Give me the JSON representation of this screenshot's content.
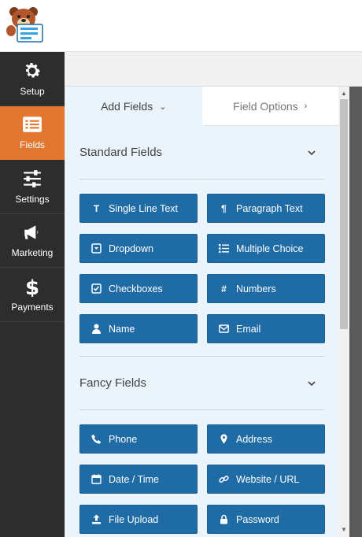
{
  "sidebar": {
    "items": [
      {
        "label": "Setup",
        "icon": "gear-icon"
      },
      {
        "label": "Fields",
        "icon": "fields-list-icon",
        "active": true
      },
      {
        "label": "Settings",
        "icon": "sliders-icon"
      },
      {
        "label": "Marketing",
        "icon": "megaphone-icon"
      },
      {
        "label": "Payments",
        "icon": "dollar-icon"
      }
    ]
  },
  "tabs": {
    "add_fields": "Add Fields",
    "field_options": "Field Options"
  },
  "standard": {
    "title": "Standard Fields",
    "buttons": [
      {
        "label": "Single Line Text",
        "icon": "text-icon"
      },
      {
        "label": "Paragraph Text",
        "icon": "paragraph-icon"
      },
      {
        "label": "Dropdown",
        "icon": "dropdown-icon"
      },
      {
        "label": "Multiple Choice",
        "icon": "list-icon"
      },
      {
        "label": "Checkboxes",
        "icon": "checkbox-icon"
      },
      {
        "label": "Numbers",
        "icon": "hash-icon"
      },
      {
        "label": "Name",
        "icon": "user-icon"
      },
      {
        "label": "Email",
        "icon": "envelope-icon"
      }
    ]
  },
  "fancy": {
    "title": "Fancy Fields",
    "buttons": [
      {
        "label": "Phone",
        "icon": "phone-icon"
      },
      {
        "label": "Address",
        "icon": "map-pin-icon"
      },
      {
        "label": "Date / Time",
        "icon": "calendar-icon"
      },
      {
        "label": "Website / URL",
        "icon": "link-icon"
      },
      {
        "label": "File Upload",
        "icon": "upload-icon"
      },
      {
        "label": "Password",
        "icon": "lock-icon"
      }
    ]
  },
  "colors": {
    "sidebar_bg": "#2d2d2d",
    "active_orange": "#e27730",
    "button_blue": "#1f6ba6",
    "panel_bg": "#ebf3fb"
  }
}
